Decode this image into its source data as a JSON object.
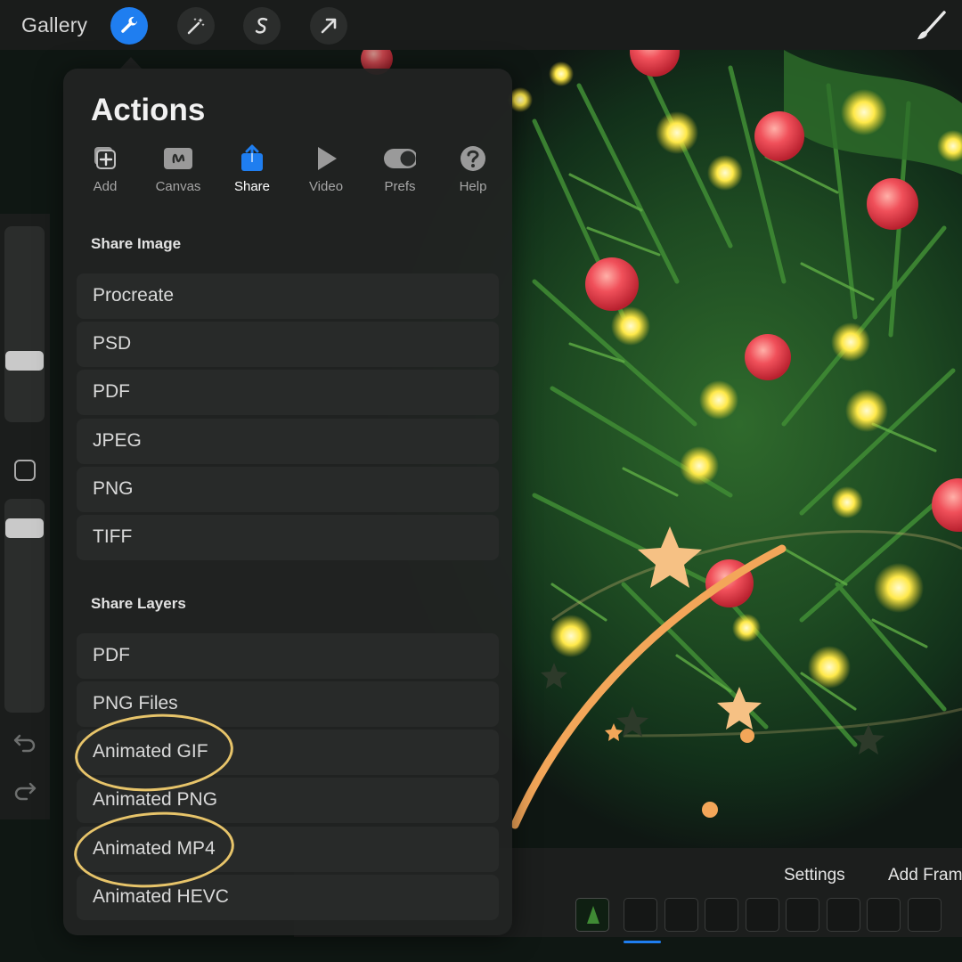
{
  "topbar": {
    "gallery_label": "Gallery",
    "tools": [
      "wrench-icon",
      "magic-wand-icon",
      "selection-s-icon",
      "transform-arrow-icon"
    ],
    "brush_tool": "brush-icon",
    "accent_color": "#1f7ef0"
  },
  "actions": {
    "title": "Actions",
    "tabs": [
      {
        "label": "Add",
        "icon": "add-icon"
      },
      {
        "label": "Canvas",
        "icon": "canvas-icon"
      },
      {
        "label": "Share",
        "icon": "share-icon",
        "active": true
      },
      {
        "label": "Video",
        "icon": "play-icon"
      },
      {
        "label": "Prefs",
        "icon": "toggle-icon"
      },
      {
        "label": "Help",
        "icon": "question-icon"
      }
    ],
    "share_image": {
      "heading": "Share Image",
      "options": [
        "Procreate",
        "PSD",
        "PDF",
        "JPEG",
        "PNG",
        "TIFF"
      ]
    },
    "share_layers": {
      "heading": "Share Layers",
      "options": [
        "PDF",
        "PNG Files",
        "Animated GIF",
        "Animated PNG",
        "Animated MP4",
        "Animated HEVC"
      ],
      "circled": [
        "Animated GIF",
        "Animated MP4"
      ]
    }
  },
  "timeline": {
    "settings_label": "Settings",
    "add_frame_label": "Add Frame",
    "frame_count_visible": 10
  },
  "colors": {
    "highlight": "#e7c46a",
    "panel": "#212322"
  }
}
